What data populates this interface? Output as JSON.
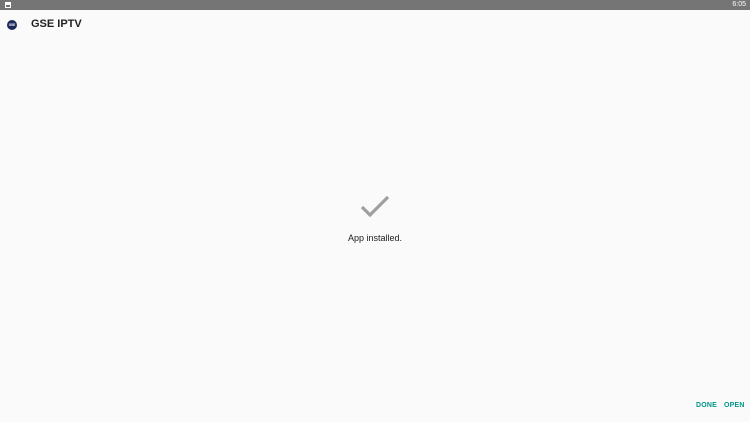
{
  "status_bar": {
    "time": "6:05",
    "notification_icon": "image-notification-icon"
  },
  "app": {
    "icon_text": "GSE",
    "title": "GSE IPTV"
  },
  "main": {
    "status_icon": "check-icon",
    "message": "App installed."
  },
  "actions": {
    "done_label": "DONE",
    "open_label": "OPEN"
  },
  "colors": {
    "status_bar": "#757575",
    "background": "#fafafa",
    "accent": "#009688",
    "check": "#9e9e9e",
    "text": "#212121"
  }
}
